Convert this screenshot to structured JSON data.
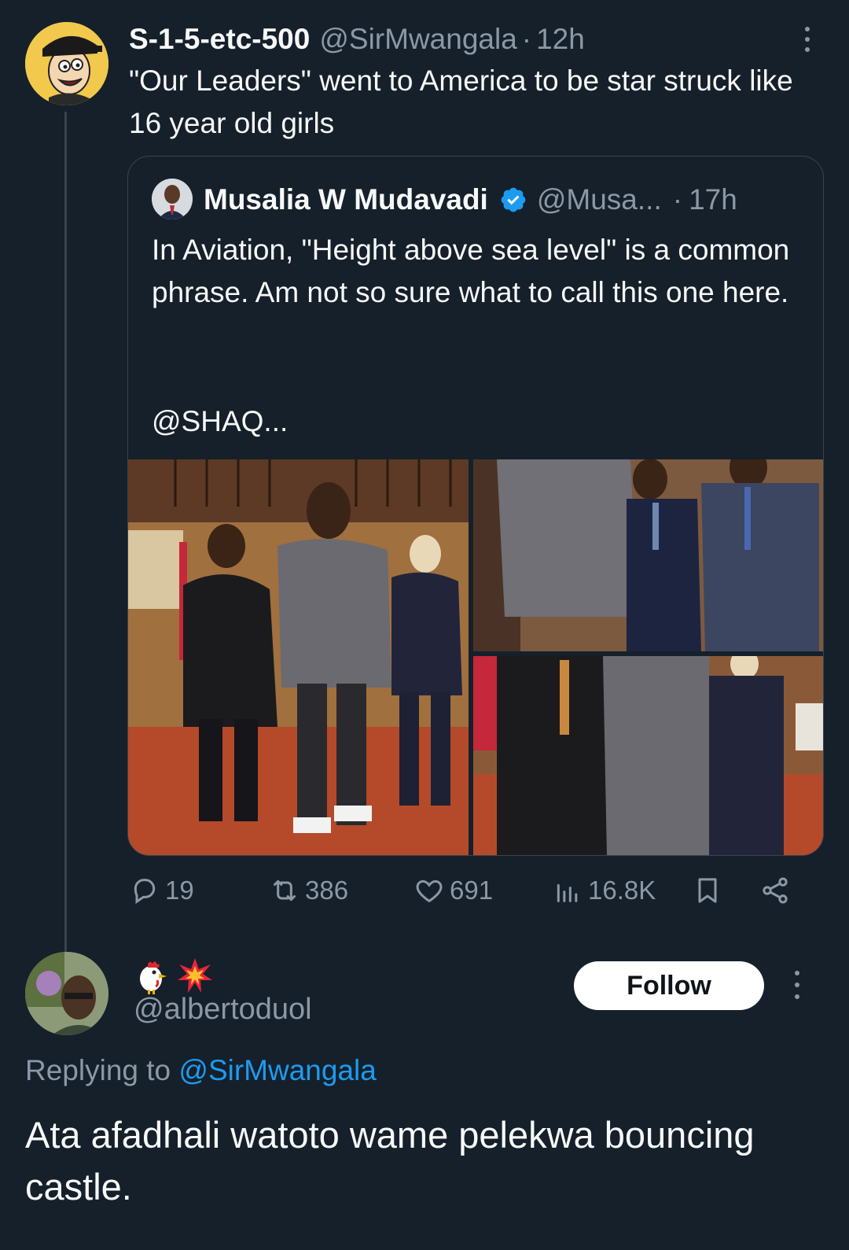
{
  "tweet": {
    "display_name": "S-1-5-etc-500",
    "handle": "@SirMwangala",
    "separator": "·",
    "time": "12h",
    "text": "\"Our Leaders\" went to America to be star struck like 16 year old girls"
  },
  "quote": {
    "display_name": "Musalia W Mudavadi",
    "handle": "@Musa...",
    "separator": "·",
    "time": "17h",
    "verified_color": "#1d9bf0",
    "text": "In Aviation, \"Height above sea level\" is a common phrase. Am not so sure what to call this one here.",
    "overflow_text": "@SHAQ..."
  },
  "actions": {
    "replies": "19",
    "reposts": "386",
    "likes": "691",
    "views": "16.8K",
    "icons": [
      "reply-icon",
      "repost-icon",
      "like-icon",
      "views-icon",
      "bookmark-icon",
      "share-icon"
    ]
  },
  "reply": {
    "display_name_emojis": [
      "chicken-emoji",
      "collision-emoji"
    ],
    "handle": "@albertoduol",
    "follow_label": "Follow",
    "replying_prefix": "Replying to",
    "replying_to": "@SirMwangala",
    "text": "Ata afadhali watoto wame pelekwa bouncing castle."
  },
  "colors": {
    "background": "#15202b",
    "secondary_text": "#8b98a5",
    "accent": "#1d9bf0",
    "border": "#38444d"
  }
}
